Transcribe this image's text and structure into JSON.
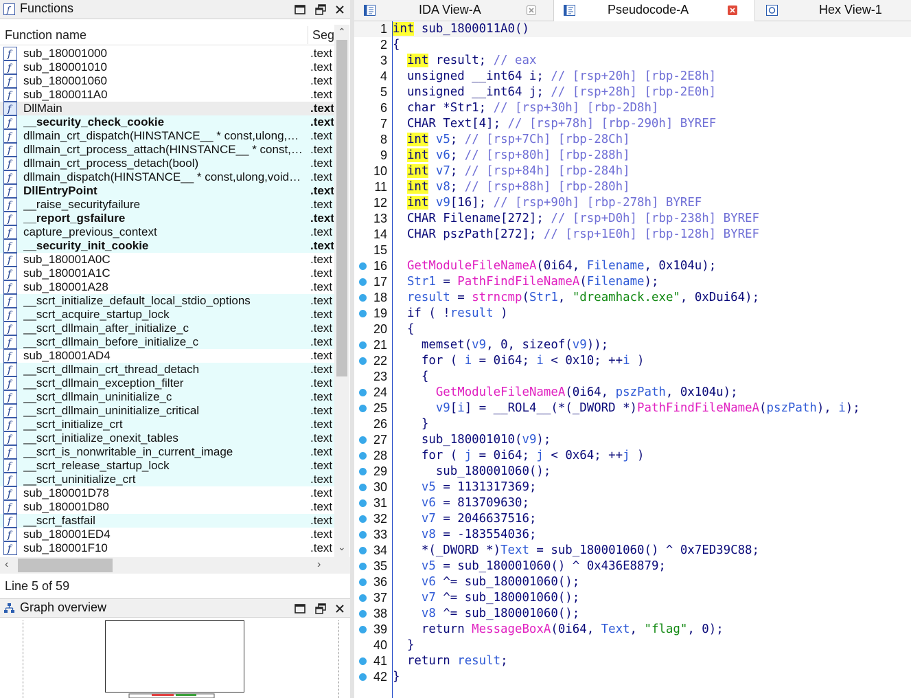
{
  "functions_pane": {
    "title": "Functions",
    "title_icon": "f-icon",
    "col_name": "Function name",
    "col_segment": "Seg",
    "status": "Line 5 of 59",
    "rows": [
      {
        "name": "sub_180001000",
        "seg": ".text",
        "lib": false,
        "bold": false,
        "sel": false
      },
      {
        "name": "sub_180001010",
        "seg": ".text",
        "lib": false,
        "bold": false,
        "sel": false
      },
      {
        "name": "sub_180001060",
        "seg": ".text",
        "lib": false,
        "bold": false,
        "sel": false
      },
      {
        "name": "sub_1800011A0",
        "seg": ".text",
        "lib": false,
        "bold": false,
        "sel": false
      },
      {
        "name": "DllMain",
        "seg": ".text",
        "lib": false,
        "bold": false,
        "sel": true
      },
      {
        "name": "__security_check_cookie",
        "seg": ".text",
        "lib": true,
        "bold": true,
        "sel": false
      },
      {
        "name": "dllmain_crt_dispatch(HINSTANCE__ * const,ulong,void * const)",
        "seg": ".text",
        "lib": true,
        "bold": false,
        "sel": false
      },
      {
        "name": "dllmain_crt_process_attach(HINSTANCE__ * const,void * const)",
        "seg": ".text",
        "lib": true,
        "bold": false,
        "sel": false
      },
      {
        "name": "dllmain_crt_process_detach(bool)",
        "seg": ".text",
        "lib": true,
        "bold": false,
        "sel": false
      },
      {
        "name": "dllmain_dispatch(HINSTANCE__ * const,ulong,void * const)",
        "seg": ".text",
        "lib": true,
        "bold": false,
        "sel": false
      },
      {
        "name": "DllEntryPoint",
        "seg": ".text",
        "lib": true,
        "bold": true,
        "sel": false
      },
      {
        "name": "__raise_securityfailure",
        "seg": ".text",
        "lib": true,
        "bold": false,
        "sel": false
      },
      {
        "name": "__report_gsfailure",
        "seg": ".text",
        "lib": true,
        "bold": true,
        "sel": false
      },
      {
        "name": "capture_previous_context",
        "seg": ".text",
        "lib": true,
        "bold": false,
        "sel": false
      },
      {
        "name": "__security_init_cookie",
        "seg": ".text",
        "lib": true,
        "bold": true,
        "sel": false
      },
      {
        "name": "sub_180001A0C",
        "seg": ".text",
        "lib": false,
        "bold": false,
        "sel": false
      },
      {
        "name": "sub_180001A1C",
        "seg": ".text",
        "lib": false,
        "bold": false,
        "sel": false
      },
      {
        "name": "sub_180001A28",
        "seg": ".text",
        "lib": false,
        "bold": false,
        "sel": false
      },
      {
        "name": "__scrt_initialize_default_local_stdio_options",
        "seg": ".text",
        "lib": true,
        "bold": false,
        "sel": false
      },
      {
        "name": "__scrt_acquire_startup_lock",
        "seg": ".text",
        "lib": true,
        "bold": false,
        "sel": false
      },
      {
        "name": "__scrt_dllmain_after_initialize_c",
        "seg": ".text",
        "lib": true,
        "bold": false,
        "sel": false
      },
      {
        "name": "__scrt_dllmain_before_initialize_c",
        "seg": ".text",
        "lib": true,
        "bold": false,
        "sel": false
      },
      {
        "name": "sub_180001AD4",
        "seg": ".text",
        "lib": false,
        "bold": false,
        "sel": false
      },
      {
        "name": "__scrt_dllmain_crt_thread_detach",
        "seg": ".text",
        "lib": true,
        "bold": false,
        "sel": false
      },
      {
        "name": "__scrt_dllmain_exception_filter",
        "seg": ".text",
        "lib": true,
        "bold": false,
        "sel": false
      },
      {
        "name": "__scrt_dllmain_uninitialize_c",
        "seg": ".text",
        "lib": true,
        "bold": false,
        "sel": false
      },
      {
        "name": "__scrt_dllmain_uninitialize_critical",
        "seg": ".text",
        "lib": true,
        "bold": false,
        "sel": false
      },
      {
        "name": "__scrt_initialize_crt",
        "seg": ".text",
        "lib": true,
        "bold": false,
        "sel": false
      },
      {
        "name": "__scrt_initialize_onexit_tables",
        "seg": ".text",
        "lib": true,
        "bold": false,
        "sel": false
      },
      {
        "name": "__scrt_is_nonwritable_in_current_image",
        "seg": ".text",
        "lib": true,
        "bold": false,
        "sel": false
      },
      {
        "name": "__scrt_release_startup_lock",
        "seg": ".text",
        "lib": true,
        "bold": false,
        "sel": false
      },
      {
        "name": "__scrt_uninitialize_crt",
        "seg": ".text",
        "lib": true,
        "bold": false,
        "sel": false
      },
      {
        "name": "sub_180001D78",
        "seg": ".text",
        "lib": false,
        "bold": false,
        "sel": false
      },
      {
        "name": "sub_180001D80",
        "seg": ".text",
        "lib": false,
        "bold": false,
        "sel": false
      },
      {
        "name": "__scrt_fastfail",
        "seg": ".text",
        "lib": true,
        "bold": false,
        "sel": false
      },
      {
        "name": "sub_180001ED4",
        "seg": ".text",
        "lib": false,
        "bold": false,
        "sel": false
      },
      {
        "name": "sub_180001F10",
        "seg": ".text",
        "lib": false,
        "bold": false,
        "sel": false
      }
    ]
  },
  "graph_pane": {
    "title": "Graph overview",
    "title_icon": "graph-overview-icon"
  },
  "tabs": [
    {
      "label": "IDA View-A",
      "icon": "ida-view-icon",
      "active": false,
      "close_color": "#9a9a9a"
    },
    {
      "label": "Pseudocode-A",
      "icon": "pseudocode-icon",
      "active": true,
      "close_color": "#e04a3a"
    },
    {
      "label": "Hex View-1",
      "icon": "hex-view-icon",
      "active": false,
      "close_color": ""
    }
  ],
  "colors": {
    "keyword": "#0b0b7a",
    "function": "#e020c0",
    "variable": "#2f5ad6",
    "comment": "#6f6fd6",
    "string": "#138a13",
    "highlight": "#ffff33",
    "library_row": "#e6fcfc",
    "breakpoint_dot": "#39a9ea"
  },
  "code": [
    {
      "n": "1",
      "bp": false,
      "cur": true,
      "t": [
        [
          "kwh",
          "int"
        ],
        [
          "pl",
          " sub_1800011A0()"
        ]
      ]
    },
    {
      "n": "2",
      "bp": false,
      "t": [
        [
          "pl",
          "{"
        ]
      ]
    },
    {
      "n": "3",
      "bp": false,
      "t": [
        [
          "pl",
          "  "
        ],
        [
          "kwh",
          "int"
        ],
        [
          "pl",
          " result; "
        ],
        [
          "cmt",
          "// eax"
        ]
      ]
    },
    {
      "n": "4",
      "bp": false,
      "t": [
        [
          "pl",
          "  unsigned __int64 i; "
        ],
        [
          "cmt",
          "// [rsp+20h] [rbp-2E8h]"
        ]
      ]
    },
    {
      "n": "5",
      "bp": false,
      "t": [
        [
          "pl",
          "  unsigned __int64 j; "
        ],
        [
          "cmt",
          "// [rsp+28h] [rbp-2E0h]"
        ]
      ]
    },
    {
      "n": "6",
      "bp": false,
      "t": [
        [
          "pl",
          "  char *Str1; "
        ],
        [
          "cmt",
          "// [rsp+30h] [rbp-2D8h]"
        ]
      ]
    },
    {
      "n": "7",
      "bp": false,
      "t": [
        [
          "pl",
          "  CHAR Text[4]; "
        ],
        [
          "cmt",
          "// [rsp+78h] [rbp-290h] BYREF"
        ]
      ]
    },
    {
      "n": "8",
      "bp": false,
      "t": [
        [
          "pl",
          "  "
        ],
        [
          "kwh",
          "int"
        ],
        [
          "pl",
          " "
        ],
        [
          "var",
          "v5"
        ],
        [
          "pl",
          "; "
        ],
        [
          "cmt",
          "// [rsp+7Ch] [rbp-28Ch]"
        ]
      ]
    },
    {
      "n": "9",
      "bp": false,
      "t": [
        [
          "pl",
          "  "
        ],
        [
          "kwh",
          "int"
        ],
        [
          "pl",
          " "
        ],
        [
          "var",
          "v6"
        ],
        [
          "pl",
          "; "
        ],
        [
          "cmt",
          "// [rsp+80h] [rbp-288h]"
        ]
      ]
    },
    {
      "n": "10",
      "bp": false,
      "t": [
        [
          "pl",
          "  "
        ],
        [
          "kwh",
          "int"
        ],
        [
          "pl",
          " "
        ],
        [
          "var",
          "v7"
        ],
        [
          "pl",
          "; "
        ],
        [
          "cmt",
          "// [rsp+84h] [rbp-284h]"
        ]
      ]
    },
    {
      "n": "11",
      "bp": false,
      "t": [
        [
          "pl",
          "  "
        ],
        [
          "kwh",
          "int"
        ],
        [
          "pl",
          " "
        ],
        [
          "var",
          "v8"
        ],
        [
          "pl",
          "; "
        ],
        [
          "cmt",
          "// [rsp+88h] [rbp-280h]"
        ]
      ]
    },
    {
      "n": "12",
      "bp": false,
      "t": [
        [
          "pl",
          "  "
        ],
        [
          "kwh",
          "int"
        ],
        [
          "pl",
          " "
        ],
        [
          "var",
          "v9"
        ],
        [
          "pl",
          "[16]; "
        ],
        [
          "cmt",
          "// [rsp+90h] [rbp-278h] BYREF"
        ]
      ]
    },
    {
      "n": "13",
      "bp": false,
      "t": [
        [
          "pl",
          "  CHAR Filename[272]; "
        ],
        [
          "cmt",
          "// [rsp+D0h] [rbp-238h] BYREF"
        ]
      ]
    },
    {
      "n": "14",
      "bp": false,
      "t": [
        [
          "pl",
          "  CHAR pszPath[272]; "
        ],
        [
          "cmt",
          "// [rsp+1E0h] [rbp-128h] BYREF"
        ]
      ]
    },
    {
      "n": "15",
      "bp": false,
      "t": [
        [
          "pl",
          ""
        ]
      ]
    },
    {
      "n": "16",
      "bp": true,
      "t": [
        [
          "pl",
          "  "
        ],
        [
          "fn",
          "GetModuleFileNameA"
        ],
        [
          "pl",
          "(0i64, "
        ],
        [
          "var",
          "Filename"
        ],
        [
          "pl",
          ", 0x104u);"
        ]
      ]
    },
    {
      "n": "17",
      "bp": true,
      "t": [
        [
          "pl",
          "  "
        ],
        [
          "var",
          "Str1"
        ],
        [
          "pl",
          " = "
        ],
        [
          "fn",
          "PathFindFileNameA"
        ],
        [
          "pl",
          "("
        ],
        [
          "var",
          "Filename"
        ],
        [
          "pl",
          ");"
        ]
      ]
    },
    {
      "n": "18",
      "bp": true,
      "t": [
        [
          "pl",
          "  "
        ],
        [
          "var",
          "result"
        ],
        [
          "pl",
          " = "
        ],
        [
          "fn",
          "strncmp"
        ],
        [
          "pl",
          "("
        ],
        [
          "var",
          "Str1"
        ],
        [
          "pl",
          ", "
        ],
        [
          "str",
          "\"dreamhack.exe\""
        ],
        [
          "pl",
          ", 0xDui64);"
        ]
      ]
    },
    {
      "n": "19",
      "bp": true,
      "t": [
        [
          "pl",
          "  if ( !"
        ],
        [
          "var",
          "result"
        ],
        [
          "pl",
          " )"
        ]
      ]
    },
    {
      "n": "20",
      "bp": false,
      "t": [
        [
          "pl",
          "  {"
        ]
      ]
    },
    {
      "n": "21",
      "bp": true,
      "t": [
        [
          "pl",
          "    memset("
        ],
        [
          "var",
          "v9"
        ],
        [
          "pl",
          ", 0, sizeof("
        ],
        [
          "var",
          "v9"
        ],
        [
          "pl",
          "));"
        ]
      ]
    },
    {
      "n": "22",
      "bp": true,
      "t": [
        [
          "pl",
          "    for ( "
        ],
        [
          "var",
          "i"
        ],
        [
          "pl",
          " = 0i64; "
        ],
        [
          "var",
          "i"
        ],
        [
          "pl",
          " < 0x10; ++"
        ],
        [
          "var",
          "i"
        ],
        [
          "pl",
          " )"
        ]
      ]
    },
    {
      "n": "23",
      "bp": false,
      "t": [
        [
          "pl",
          "    {"
        ]
      ]
    },
    {
      "n": "24",
      "bp": true,
      "t": [
        [
          "pl",
          "      "
        ],
        [
          "fn",
          "GetModuleFileNameA"
        ],
        [
          "pl",
          "(0i64, "
        ],
        [
          "var",
          "pszPath"
        ],
        [
          "pl",
          ", 0x104u);"
        ]
      ]
    },
    {
      "n": "25",
      "bp": true,
      "t": [
        [
          "pl",
          "      "
        ],
        [
          "var",
          "v9"
        ],
        [
          "pl",
          "["
        ],
        [
          "var",
          "i"
        ],
        [
          "pl",
          "] = __ROL4__(*(_DWORD *)"
        ],
        [
          "fn",
          "PathFindFileNameA"
        ],
        [
          "pl",
          "("
        ],
        [
          "var",
          "pszPath"
        ],
        [
          "pl",
          "), "
        ],
        [
          "var",
          "i"
        ],
        [
          "pl",
          ");"
        ]
      ]
    },
    {
      "n": "26",
      "bp": false,
      "t": [
        [
          "pl",
          "    }"
        ]
      ]
    },
    {
      "n": "27",
      "bp": true,
      "t": [
        [
          "pl",
          "    sub_180001010("
        ],
        [
          "var",
          "v9"
        ],
        [
          "pl",
          ");"
        ]
      ]
    },
    {
      "n": "28",
      "bp": true,
      "t": [
        [
          "pl",
          "    for ( "
        ],
        [
          "var",
          "j"
        ],
        [
          "pl",
          " = 0i64; "
        ],
        [
          "var",
          "j"
        ],
        [
          "pl",
          " < 0x64; ++"
        ],
        [
          "var",
          "j"
        ],
        [
          "pl",
          " )"
        ]
      ]
    },
    {
      "n": "29",
      "bp": true,
      "t": [
        [
          "pl",
          "      sub_180001060();"
        ]
      ]
    },
    {
      "n": "30",
      "bp": true,
      "t": [
        [
          "pl",
          "    "
        ],
        [
          "var",
          "v5"
        ],
        [
          "pl",
          " = 1131317369;"
        ]
      ]
    },
    {
      "n": "31",
      "bp": true,
      "t": [
        [
          "pl",
          "    "
        ],
        [
          "var",
          "v6"
        ],
        [
          "pl",
          " = 813709630;"
        ]
      ]
    },
    {
      "n": "32",
      "bp": true,
      "t": [
        [
          "pl",
          "    "
        ],
        [
          "var",
          "v7"
        ],
        [
          "pl",
          " = 2046637516;"
        ]
      ]
    },
    {
      "n": "33",
      "bp": true,
      "t": [
        [
          "pl",
          "    "
        ],
        [
          "var",
          "v8"
        ],
        [
          "pl",
          " = -183554036;"
        ]
      ]
    },
    {
      "n": "34",
      "bp": true,
      "t": [
        [
          "pl",
          "    *(_DWORD *)"
        ],
        [
          "var",
          "Text"
        ],
        [
          "pl",
          " = sub_180001060() ^ 0x7ED39C88;"
        ]
      ]
    },
    {
      "n": "35",
      "bp": true,
      "t": [
        [
          "pl",
          "    "
        ],
        [
          "var",
          "v5"
        ],
        [
          "pl",
          " = sub_180001060() ^ 0x436E8879;"
        ]
      ]
    },
    {
      "n": "36",
      "bp": true,
      "t": [
        [
          "pl",
          "    "
        ],
        [
          "var",
          "v6"
        ],
        [
          "pl",
          " ^= sub_180001060();"
        ]
      ]
    },
    {
      "n": "37",
      "bp": true,
      "t": [
        [
          "pl",
          "    "
        ],
        [
          "var",
          "v7"
        ],
        [
          "pl",
          " ^= sub_180001060();"
        ]
      ]
    },
    {
      "n": "38",
      "bp": true,
      "t": [
        [
          "pl",
          "    "
        ],
        [
          "var",
          "v8"
        ],
        [
          "pl",
          " ^= sub_180001060();"
        ]
      ]
    },
    {
      "n": "39",
      "bp": true,
      "t": [
        [
          "pl",
          "    return "
        ],
        [
          "fn",
          "MessageBoxA"
        ],
        [
          "pl",
          "(0i64, "
        ],
        [
          "var",
          "Text"
        ],
        [
          "pl",
          ", "
        ],
        [
          "str",
          "\"flag\""
        ],
        [
          "pl",
          ", 0);"
        ]
      ]
    },
    {
      "n": "40",
      "bp": false,
      "t": [
        [
          "pl",
          "  }"
        ]
      ]
    },
    {
      "n": "41",
      "bp": true,
      "t": [
        [
          "pl",
          "  return "
        ],
        [
          "var",
          "result"
        ],
        [
          "pl",
          ";"
        ]
      ]
    },
    {
      "n": "42",
      "bp": true,
      "t": [
        [
          "pl",
          "}"
        ]
      ]
    }
  ]
}
